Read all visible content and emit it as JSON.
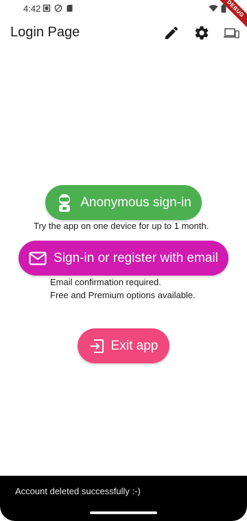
{
  "status_bar": {
    "time": "4:42",
    "left_icons": [
      "screenshot-icon",
      "shield-icon",
      "sd-card-icon"
    ],
    "right_icons": [
      "wifi-icon",
      "battery-icon"
    ],
    "debug_banner": "DEBUG"
  },
  "app_bar": {
    "title": "Login Page",
    "actions": [
      "pencil-icon",
      "gear-icon",
      "devices-icon"
    ]
  },
  "main": {
    "anonymous_button": "Anonymous sign-in",
    "anonymous_caption": "Try the app on one device for up to 1 month.",
    "email_button": "Sign-in or register with email",
    "email_caption_line1": "Email confirmation required.",
    "email_caption_line2": "Free and Premium options available.",
    "exit_button": "Exit app"
  },
  "snackbar": {
    "message": "Account deleted successfully :-)"
  },
  "colors": {
    "anonymous": "#4caf50",
    "email": "#d01ab0",
    "exit": "#f0487c"
  }
}
